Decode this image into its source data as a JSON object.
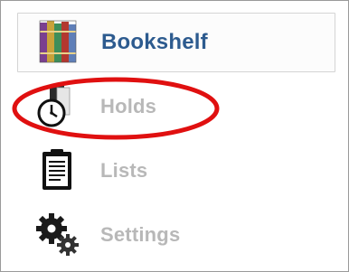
{
  "nav": {
    "items": [
      {
        "label": "Bookshelf",
        "icon": "bookshelf-icon",
        "active": true
      },
      {
        "label": "Holds",
        "icon": "holds-clock-icon",
        "active": false
      },
      {
        "label": "Lists",
        "icon": "lists-clipboard-icon",
        "active": false
      },
      {
        "label": "Settings",
        "icon": "settings-gears-icon",
        "active": false
      }
    ]
  },
  "annotation": {
    "highlight_color": "#e01010",
    "highlighted_item": "Holds"
  },
  "colors": {
    "active_text": "#2d5b8f",
    "inactive_text": "#b8b8b8"
  }
}
